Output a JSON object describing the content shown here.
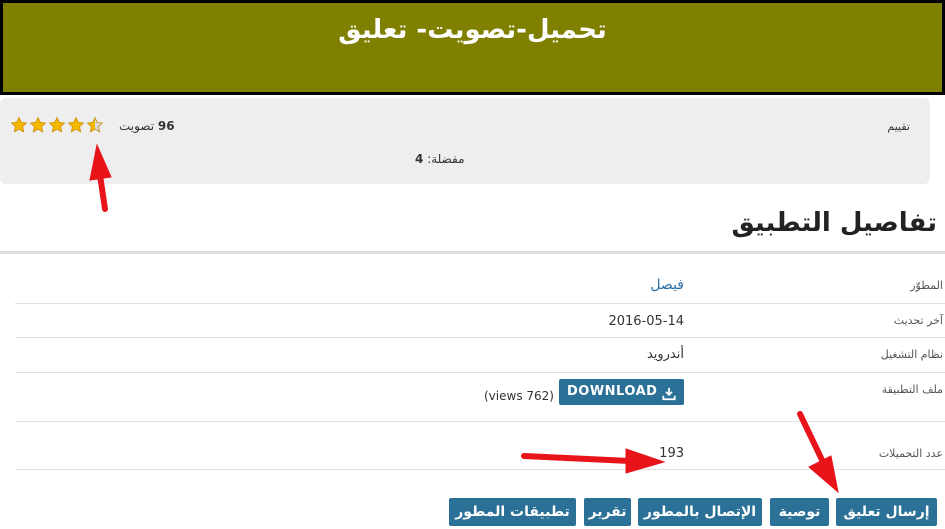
{
  "banner": {
    "title": "تحميل-تصويت- تعليق",
    "color": "#808000"
  },
  "rating": {
    "label": "تقييم",
    "stars": 4.5,
    "star_count": 5,
    "votes_count": "96",
    "votes_label": "تصويت",
    "favorites_count": "4",
    "favorites_label": "مفضلة:"
  },
  "details": {
    "title": "تفاصيل التطبيق",
    "developer_label": "المطوّر",
    "developer_value": "فيصل",
    "updated_label": "آخر تحديث",
    "updated_value": "2016-05-14",
    "os_label": "نظام التشغيل",
    "os_value": "أندرويد",
    "file_label": "ملف التطبيقة",
    "download_label": "DOWNLOAD",
    "views_text": "(views 762)",
    "downloads_label": "عدد التحميلات",
    "downloads_value": "193"
  },
  "actions": {
    "comment": "إرسال تعليق",
    "recommend": "توصية",
    "contact": "الإتصال بالمطور",
    "report": "تقرير",
    "dev_apps": "تطبيقات المطور"
  },
  "colors": {
    "button": "#2a7097",
    "star": "#f5b800",
    "arrow": "#e8141a",
    "link": "#2b6ea6"
  }
}
